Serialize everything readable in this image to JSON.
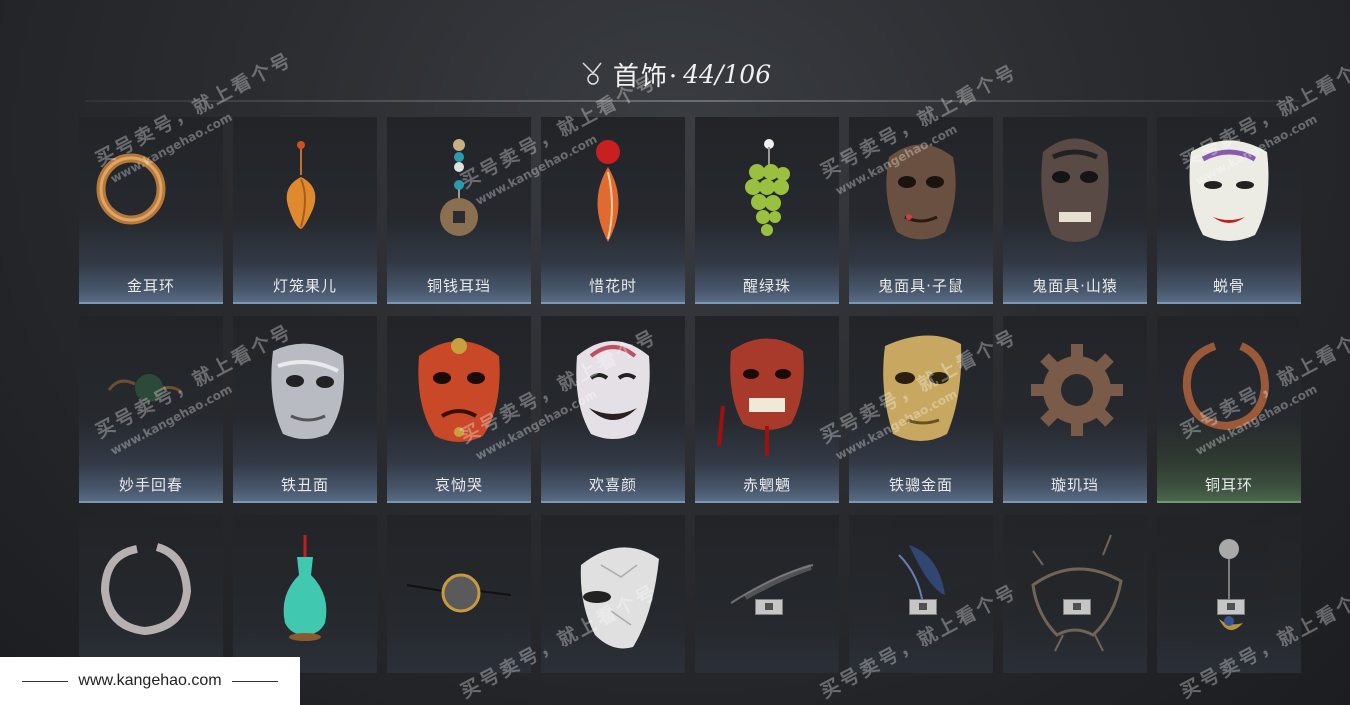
{
  "header": {
    "title": "首饰·",
    "count": "44/106"
  },
  "items": [
    {
      "name": "金耳环",
      "icon": "gold-earring-icon",
      "locked": false
    },
    {
      "name": "灯笼果儿",
      "icon": "lantern-fruit-icon",
      "locked": false
    },
    {
      "name": "铜钱耳珰",
      "icon": "copper-coin-earring-icon",
      "locked": false
    },
    {
      "name": "惜花时",
      "icon": "flower-petal-icon",
      "locked": false
    },
    {
      "name": "醒绿珠",
      "icon": "green-grape-icon",
      "locked": false
    },
    {
      "name": "鬼面具·子鼠",
      "icon": "rat-mask-icon",
      "locked": false
    },
    {
      "name": "鬼面具·山猿",
      "icon": "monkey-mask-icon",
      "locked": false
    },
    {
      "name": "蜕骨",
      "icon": "white-mask-icon",
      "locked": false
    },
    {
      "name": "妙手回春",
      "icon": "bead-necklace-icon",
      "locked": false
    },
    {
      "name": "铁丑面",
      "icon": "iron-mask-icon",
      "locked": false
    },
    {
      "name": "哀恸哭",
      "icon": "red-mask-icon",
      "locked": false
    },
    {
      "name": "欢喜颜",
      "icon": "smiling-mask-icon",
      "locked": false
    },
    {
      "name": "赤魍魉",
      "icon": "red-demon-mask-icon",
      "locked": false
    },
    {
      "name": "铁骢金面",
      "icon": "gold-mask-icon",
      "locked": false
    },
    {
      "name": "璇玑珰",
      "icon": "gear-ring-icon",
      "locked": false
    },
    {
      "name": "铜耳环",
      "icon": "copper-earring-icon",
      "locked": false
    },
    {
      "name": "",
      "icon": "silver-ring-icon",
      "locked": false
    },
    {
      "name": "",
      "icon": "jade-vase-icon",
      "locked": false
    },
    {
      "name": "",
      "icon": "monocle-icon",
      "locked": false
    },
    {
      "name": "",
      "icon": "paper-mask-icon",
      "locked": false
    },
    {
      "name": "",
      "icon": "feather-icon",
      "locked": true
    },
    {
      "name": "",
      "icon": "blue-feather-icon",
      "locked": true
    },
    {
      "name": "",
      "icon": "thorn-mask-icon",
      "locked": true
    },
    {
      "name": "",
      "icon": "moon-pendant-icon",
      "locked": true
    }
  ],
  "watermark": {
    "big": "买号卖号，就上看个号",
    "small": "www.kangehao.com",
    "tag": "看个号"
  },
  "footer": {
    "url": "www.kangehao.com"
  }
}
